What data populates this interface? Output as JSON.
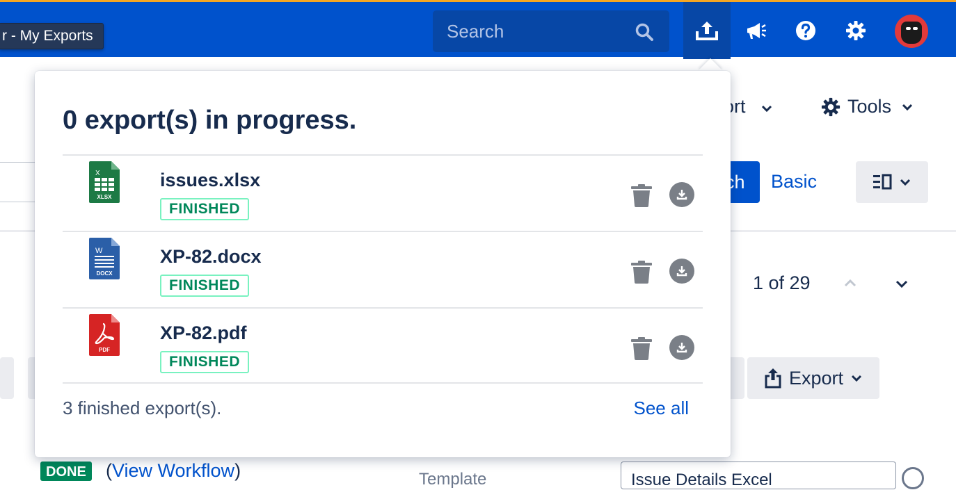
{
  "topbar": {
    "tooltip": "r - My Exports",
    "search_placeholder": "Search",
    "nav_icons": [
      "export-icon",
      "megaphone-icon",
      "help-icon",
      "gear-icon"
    ],
    "brand_color": "#0052cc"
  },
  "background": {
    "export_menu_fragment": "ort",
    "tools_label": "Tools",
    "search_button_fragment": "ch",
    "basic_link": "Basic",
    "pagination": "1 of 29",
    "export_button": "Export",
    "done_badge": "DONE",
    "view_workflow": "View Workflow",
    "template_label": "Template",
    "select_value": "Issue Details Excel"
  },
  "popup": {
    "title": "0 export(s) in progress.",
    "exports": [
      {
        "filename": "issues.xlsx",
        "type": "xlsx",
        "status": "FINISHED",
        "icon": "excel-file-icon",
        "color": "#1d7a45"
      },
      {
        "filename": "XP-82.docx",
        "type": "docx",
        "status": "FINISHED",
        "icon": "word-file-icon",
        "color": "#2b5fa8"
      },
      {
        "filename": "XP-82.pdf",
        "type": "pdf",
        "status": "FINISHED",
        "icon": "pdf-file-icon",
        "color": "#d62424"
      }
    ],
    "footer_text": "3 finished export(s).",
    "see_all": "See all"
  }
}
